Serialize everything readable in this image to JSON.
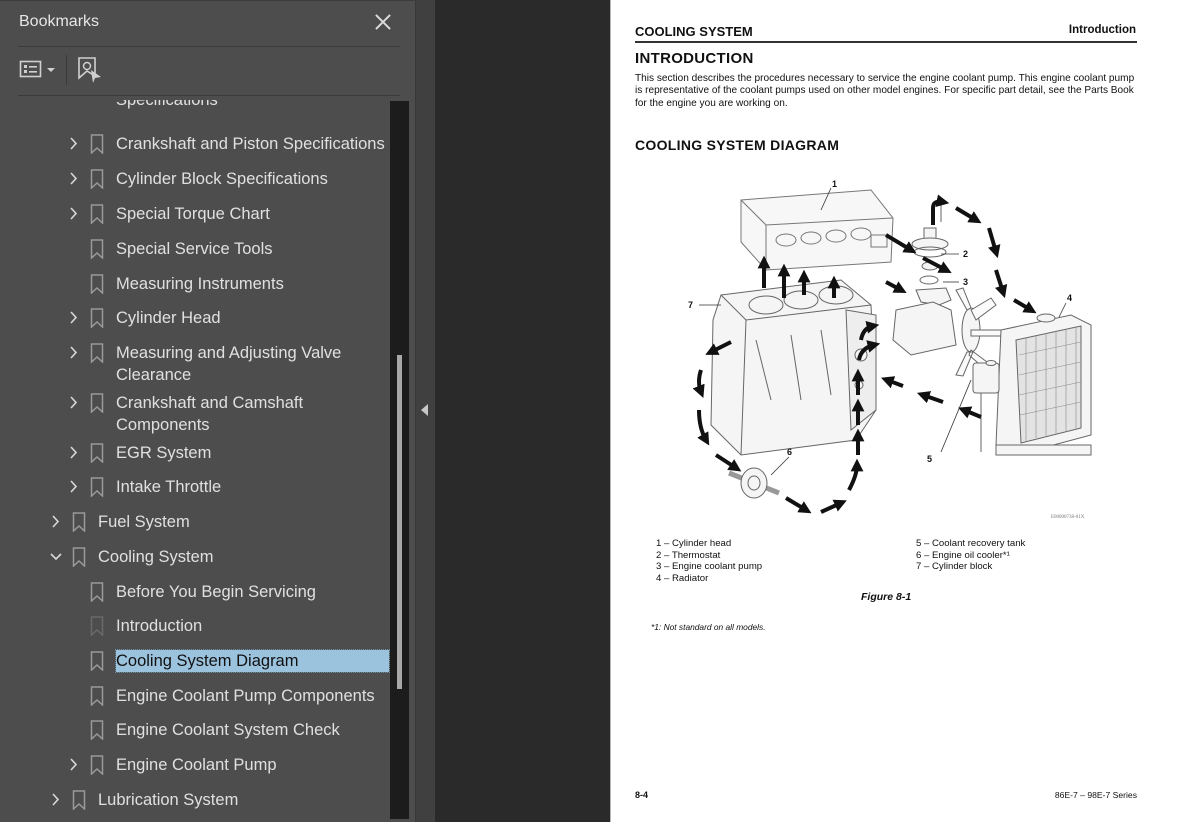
{
  "panel": {
    "title": "Bookmarks",
    "close_icon": "close-icon",
    "options_icon": "bookmark-options-icon",
    "find_icon": "find-current-bookmark-icon"
  },
  "bookmarks": [
    {
      "label": "Specifications",
      "level": 2,
      "expander": "none",
      "partial": true
    },
    {
      "label": "Crankshaft and Piston Specifications",
      "level": 2,
      "expander": "collapsed"
    },
    {
      "label": "Cylinder Block Specifications",
      "level": 2,
      "expander": "collapsed"
    },
    {
      "label": "Special Torque Chart",
      "level": 2,
      "expander": "collapsed"
    },
    {
      "label": "Special Service Tools",
      "level": 2,
      "expander": "none"
    },
    {
      "label": "Measuring Instruments",
      "level": 2,
      "expander": "none"
    },
    {
      "label": "Cylinder Head",
      "level": 2,
      "expander": "collapsed"
    },
    {
      "label": "Measuring and Adjusting Valve",
      "label2": "Clearance",
      "level": 2,
      "expander": "collapsed"
    },
    {
      "label": "Crankshaft and Camshaft",
      "label2": "Components",
      "level": 2,
      "expander": "collapsed"
    },
    {
      "label": "EGR System",
      "level": 2,
      "expander": "collapsed"
    },
    {
      "label": "Intake Throttle",
      "level": 2,
      "expander": "collapsed"
    },
    {
      "label": "Fuel System",
      "level": 1,
      "expander": "collapsed"
    },
    {
      "label": "Cooling System",
      "level": 1,
      "expander": "expanded"
    },
    {
      "label": "Before You Begin Servicing",
      "level": 2,
      "expander": "none"
    },
    {
      "label": "Introduction",
      "level": 2,
      "expander": "none",
      "dim": true
    },
    {
      "label": "Cooling System Diagram",
      "level": 2,
      "expander": "none",
      "selected": true
    },
    {
      "label": "Engine Coolant Pump Components",
      "level": 2,
      "expander": "none"
    },
    {
      "label": "Engine Coolant System Check",
      "level": 2,
      "expander": "none"
    },
    {
      "label": "Engine Coolant Pump",
      "level": 2,
      "expander": "collapsed"
    },
    {
      "label": "Lubrication System",
      "level": 1,
      "expander": "collapsed"
    }
  ],
  "page": {
    "header_left": "COOLING SYSTEM",
    "header_right": "Introduction",
    "intro_heading": "INTRODUCTION",
    "intro_text": "This section describes the procedures necessary to service the engine coolant pump. This engine coolant pump is representative of the coolant pumps used on other model engines. For specific part detail, see the Parts Book for the engine you are working on.",
    "diagram_heading": "COOLING SYSTEM DIAGRAM",
    "diagram_id": "E00000738-01X",
    "callouts": [
      "1",
      "2",
      "3",
      "4",
      "5",
      "6",
      "7"
    ],
    "legend_left": [
      "1 – Cylinder head",
      "2 – Thermostat",
      "3 – Engine coolant pump",
      "4 – Radiator"
    ],
    "legend_right": [
      "5 – Coolant recovery tank",
      "6 – Engine oil cooler*¹",
      "7 – Cylinder block"
    ],
    "figure_caption": "Figure 8-1",
    "footnote": "*1: Not standard on all models.",
    "footer_left": "8-4",
    "footer_right": "86E-7 – 98E-7 Series"
  },
  "colors": {
    "panel_bg": "#4d4d4d",
    "selection": "#9cc3de",
    "viewer_bg": "#2a2a2a"
  }
}
